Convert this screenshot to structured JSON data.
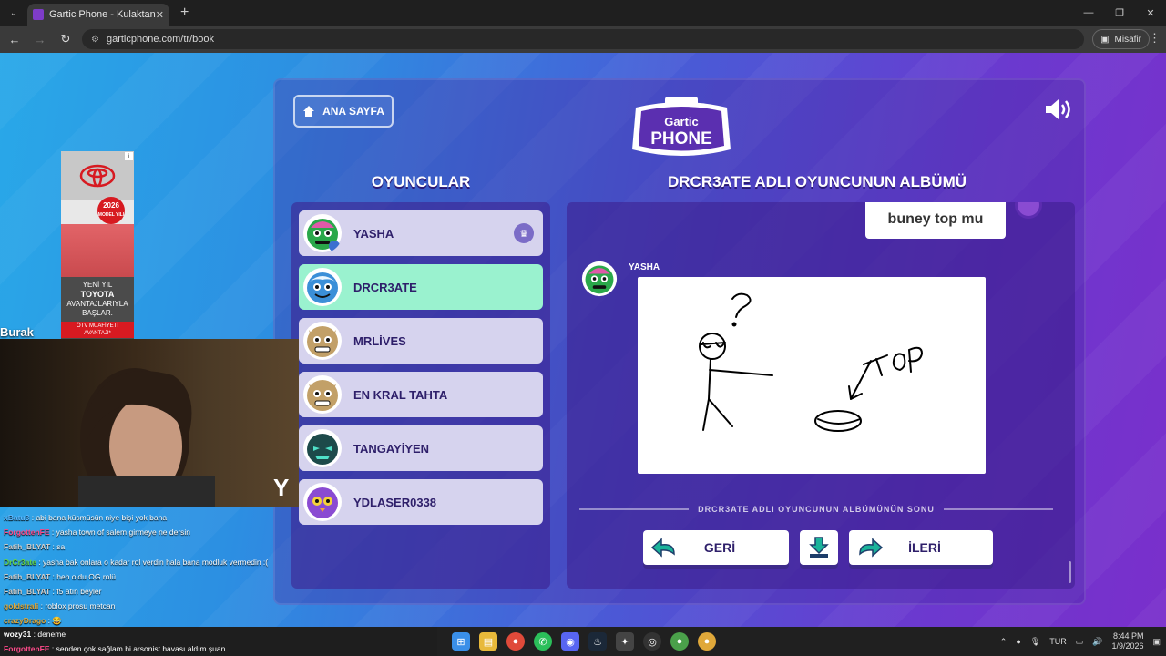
{
  "browser": {
    "tab_title": "Gartic Phone - Kulaktan Kulağa",
    "url": "garticphone.com/tr/book",
    "profile_label": "Misafir"
  },
  "game": {
    "home_button": "ANA SAYFA",
    "logo_top": "Gartic",
    "logo_bottom": "PHONE",
    "players_heading": "OYUNCULAR",
    "album_heading": "DRCR3ATE ADLI OYUNCUNUN ALBÜMÜ",
    "players": [
      {
        "name": "YASHA",
        "color": "#2aa84a",
        "host": true,
        "active": false
      },
      {
        "name": "DRCR3ATE",
        "color": "#3b8fd8",
        "host": false,
        "active": true
      },
      {
        "name": "MRLİVES",
        "color": "#c2a068",
        "host": false,
        "active": false
      },
      {
        "name": "EN KRAL TAHTA",
        "color": "#c2a068",
        "host": false,
        "active": false
      },
      {
        "name": "TANGAYİYEN",
        "color": "#1d4a4a",
        "host": false,
        "active": false
      },
      {
        "name": "YDLASER0338",
        "color": "#8a4bd2",
        "host": false,
        "active": false
      }
    ],
    "album": {
      "guess_text": "buney top mu",
      "drawer_name": "YASHA",
      "drawing_words": "?  TOP",
      "end_text": "DRCR3ATE ADLI OYUNCUNUN ALBÜMÜNÜN SONU",
      "back_button": "GERİ",
      "next_button": "İLERİ"
    }
  },
  "ad": {
    "badge_year": "2026",
    "badge_sub": "MODEL YILI",
    "line1": "YENİ YIL",
    "line2": "TOYOTA",
    "line3": "AVANTAJLARIYLA",
    "line4": "BAŞLAR.",
    "small": "ÖTV MUAFİYETİ AVANTAJI*"
  },
  "stream": {
    "cam_label": "Burak",
    "chat": [
      {
        "user": "xBatu3",
        "color": "#5bb7ff",
        "msg": "abi bana küsmüsün niye bişi yok bana"
      },
      {
        "user": "ForgottenFE",
        "color": "#ff4a8a",
        "msg": "yasha town of salem girmeye ne dersin"
      },
      {
        "user": "Fatih_BLYAT",
        "color": "#cfcfcf",
        "msg": "sa"
      },
      {
        "user": "DrCr3ate",
        "color": "#63d64a",
        "msg": "yasha bak onlara o kadar rol verdin hala bana modluk vermedin :("
      },
      {
        "user": "Fatih_BLYAT",
        "color": "#cfcfcf",
        "msg": "heh oldu OG rolü"
      },
      {
        "user": "Fatih_BLYAT",
        "color": "#cfcfcf",
        "msg": "f5 atın beyler"
      },
      {
        "user": "goldstrali",
        "color": "#e0a93a",
        "msg": "roblox prosu metcan"
      },
      {
        "user": "crazyDrago",
        "color": "#e0a93a",
        "msg": "😂"
      }
    ],
    "chat_bottom": [
      {
        "user": "wozy31",
        "color": "#ffffff",
        "msg": "deneme"
      },
      {
        "user": "ForgottenFE",
        "color": "#ff4a8a",
        "msg": "senden çok sağlam bi arsonist havası aldım şuan"
      }
    ]
  },
  "taskbar": {
    "lang": "TUR",
    "time": "8:44 PM",
    "date": "1/9/2026"
  }
}
